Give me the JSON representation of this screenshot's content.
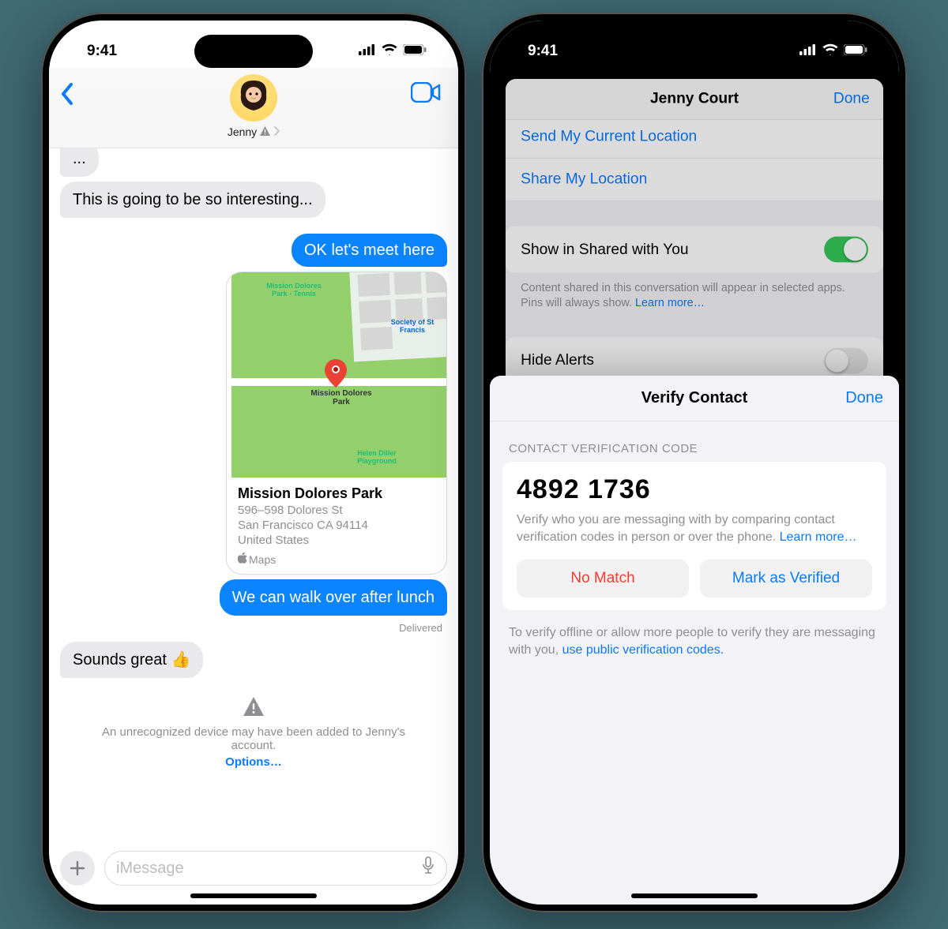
{
  "status": {
    "time": "9:41"
  },
  "left": {
    "contact_short": "Jenny",
    "messages": {
      "m1": "This is going to be so interesting...",
      "m2": "OK let's meet here",
      "m3": "We can walk over after lunch",
      "m4": "Sounds great 👍"
    },
    "card": {
      "title": "Mission Dolores Park",
      "addr1": "596–598 Dolores St",
      "addr2": "San Francisco CA 94114",
      "addr3": "United States",
      "app": "Maps",
      "pin_label": "Mission Dolores Park",
      "poi1": "Mission Dolores Park - Tennis",
      "poi2": "Society of St Francis",
      "poi3": "Helen Diller Playground"
    },
    "delivered": "Delivered",
    "warning": {
      "text": "An unrecognized device may have been added to Jenny's account.",
      "options": "Options…"
    },
    "compose_placeholder": "iMessage"
  },
  "right": {
    "behind": {
      "title": "Jenny Court",
      "done": "Done",
      "send_location": "Send My Current Location",
      "share_location": "Share My Location",
      "shared_with_you": "Show in Shared with You",
      "shared_note": "Content shared in this conversation will appear in selected apps. Pins will always show. ",
      "learn_more": "Learn more…",
      "hide_alerts": "Hide Alerts"
    },
    "front": {
      "title": "Verify Contact",
      "done": "Done",
      "section": "CONTACT VERIFICATION CODE",
      "code": "4892 1736",
      "desc": "Verify who you are messaging with by comparing contact verification codes in person or over the phone. ",
      "learn_more": "Learn more…",
      "no_match": "No Match",
      "mark_verified": "Mark as Verified",
      "offline_note": "To verify offline or allow more people to verify they are messaging with you, ",
      "offline_link": "use public verification codes."
    }
  }
}
